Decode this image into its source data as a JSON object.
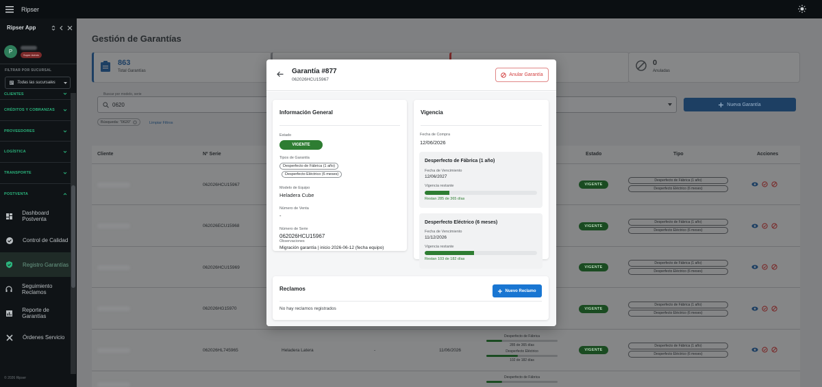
{
  "topbar": {
    "title": "Ripser"
  },
  "sidebar": {
    "app_name": "Ripser App",
    "user_initial": "P",
    "user_role": "Super Admin",
    "filter_label": "FILTRAR POR SUCURSAL",
    "branch_value": "Todas las sucursales",
    "sections": [
      "CLIENTES",
      "CRÉDITOS Y COBRANZAS",
      "PROVEEDORES",
      "LOGÍSTICA",
      "TRANSPORTE",
      "POSTVENTA"
    ],
    "items": [
      {
        "label": "Dashboard Postventa",
        "icon": "dashboard-icon"
      },
      {
        "label": "Control de Calidad",
        "icon": "check-circle-icon"
      },
      {
        "label": "Registro Garantías",
        "icon": "shield-icon"
      },
      {
        "label": "Seguimiento Reclamos",
        "icon": "headset-icon"
      },
      {
        "label": "Reporte de Garantías",
        "icon": "report-icon"
      },
      {
        "label": "Órdenes Servicio",
        "icon": "tools-icon"
      }
    ],
    "footer": "© 2026 Ripser"
  },
  "page": {
    "title": "Gestión de Garantías",
    "stats": [
      {
        "value": "863",
        "label": "Total Garantías",
        "icon": "clipboard-icon"
      },
      {
        "value": "0",
        "label": "Anuladas",
        "icon": "block-icon"
      }
    ],
    "search": {
      "label": "Buscar por modelo, serie",
      "value": "0620"
    },
    "new_button": "Nueva Garantía",
    "filter_chip": "Búsqueda: \"0620\"",
    "clear_filters": "Limpiar Filtros"
  },
  "table": {
    "headers": [
      "Cliente",
      "Nº Serie",
      "Estado",
      "Tipo",
      "Acciones"
    ],
    "rows": [
      {
        "serie": "062026HCU15967",
        "estado": "VIGENTE",
        "tipos": [
          "Desperfecto de Fábrica (1 año)",
          "Desperfecto Eléctrico (6 meses)"
        ]
      },
      {
        "serie": "062026ECU15968",
        "estado": "VIGENTE",
        "tipos": [
          "Desperfecto de Fábrica (1 año)",
          "Desperfecto Eléctrico (6 meses)"
        ]
      },
      {
        "serie": "062026HCU15969",
        "estado": "VIGENTE",
        "tipos": [
          "Desperfecto de Fábrica (1 año)",
          "Desperfecto Eléctrico (6 meses)"
        ]
      },
      {
        "serie": "062026HG15970",
        "estado": "VIGENTE",
        "tipos": [
          "Desperfecto de Fábrica (1 año)",
          "Desperfecto Eléctrico (6 meses)"
        ]
      },
      {
        "serie": "062026HL745965",
        "modelo": "Heladera Latera",
        "venta": "-",
        "fecha": "11/06/2026",
        "estado": "VIGENTE",
        "tipos": [
          "Desperfecto de Fábrica (1 año)",
          "Desperfecto Eléctrico (6 meses)"
        ],
        "vig": [
          {
            "label": "Desperfecto de Fábrica",
            "remaining": "285 de 365 días",
            "fraction": 0.22
          },
          {
            "label": "Desperfecto Eléctrico",
            "remaining": "102 de 182 días",
            "fraction": 0.44
          }
        ]
      },
      {
        "vig_label": "Desperfecto de Fábrica"
      }
    ]
  },
  "modal": {
    "title": "Garantía #877",
    "subtitle": "062026HCU15967",
    "anular": "Anular Garantía",
    "info": {
      "title": "Información General",
      "estado_label": "Estado",
      "estado": "VIGENTE",
      "tipos_label": "Tipos de Garantía",
      "tipos": [
        "Desperfecto de Fábrica (1 año)",
        "Desperfecto Eléctrico (6 meses)"
      ],
      "modelo_label": "Modelo de Equipo",
      "modelo": "Heladera Cube",
      "venta_label": "Número de Venta",
      "venta": "-",
      "serie_label": "Número de Serie",
      "serie": "062026HCU15967",
      "obs_label": "Observaciones",
      "obs": "Migración garantía | inicio 2026-06-12 (fecha equipo)"
    },
    "vigencia": {
      "title": "Vigencia",
      "compra_label": "Fecha de Compra",
      "compra": "12/06/2026",
      "items": [
        {
          "title": "Desperfecto de Fábrica (1 año)",
          "venc_label": "Fecha de Vencimiento",
          "venc": "12/06/2027",
          "vig_label": "Vigencia restante",
          "restan": "Restan 285 de 365 días",
          "fraction": 0.22
        },
        {
          "title": "Desperfecto Eléctrico (6 meses)",
          "venc_label": "Fecha de Vencimiento",
          "venc": "11/12/2026",
          "vig_label": "Vigencia restante",
          "restan": "Restan 103 de 182 días",
          "fraction": 0.44
        }
      ]
    },
    "reclamos": {
      "title": "Reclamos",
      "button": "Nuevo Reclamo",
      "empty": "No hay reclamos registrados"
    }
  },
  "colors": {
    "accent": "#1976d2",
    "success": "#2e7d32",
    "danger": "#d23c3c",
    "sidebar_section": "#2bb57d"
  }
}
